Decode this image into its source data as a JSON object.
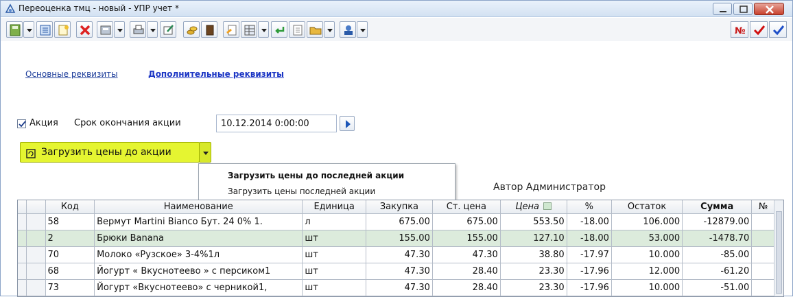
{
  "window": {
    "title": "Переоценка тмц - новый - УПР учет *"
  },
  "tabs": {
    "basic": "Основные реквизиты",
    "extra": "Дополнительные реквизиты"
  },
  "promo": {
    "checkbox_label": "Акция",
    "end_label": "Срок окончания акции",
    "end_value": "10.12.2014 0:00:00",
    "checked": true
  },
  "load_button": {
    "label": "Загрузить цены до акции"
  },
  "menu": {
    "items": [
      "Загрузить цены до последней акции",
      "Загрузить цены последней акции"
    ]
  },
  "author": "Автор Администратор",
  "table": {
    "columns": [
      "Код",
      "Наименование",
      "Единица",
      "Закупка",
      "Ст. цена",
      "Цена",
      "%",
      "Остаток",
      "Сумма",
      "№"
    ],
    "rows": [
      {
        "code": "58",
        "name": "Вермут Martini Bianco Бут. 24 0% 1.",
        "unit": "л",
        "purchase": "675.00",
        "old_price": "675.00",
        "price": "553.50",
        "pct": "-18.00",
        "stock": "106.000",
        "sum": "-12879.00"
      },
      {
        "code": "2",
        "name": "Брюки Banana",
        "unit": "шт",
        "purchase": "155.00",
        "old_price": "155.00",
        "price": "127.10",
        "pct": "-18.00",
        "stock": "53.000",
        "sum": "-1478.70"
      },
      {
        "code": "70",
        "name": "Молоко «Рузское» 3-4%1л",
        "unit": "шт",
        "purchase": "47.30",
        "old_price": "47.30",
        "price": "38.80",
        "pct": "-17.97",
        "stock": "10.000",
        "sum": "-85.00"
      },
      {
        "code": "68",
        "name": "Йогурт « Вкуснотеево » с персиком1",
        "unit": "шт",
        "purchase": "47.30",
        "old_price": "28.40",
        "price": "23.30",
        "pct": "-17.96",
        "stock": "12.000",
        "sum": "-61.20"
      },
      {
        "code": "73",
        "name": "Йогурт «Вкуснотеево» с черникой1,",
        "unit": "шт",
        "purchase": "47.30",
        "old_price": "28.40",
        "price": "23.30",
        "pct": "-17.96",
        "stock": "10.000",
        "sum": "-51.00"
      }
    ]
  },
  "colors": {
    "accent_button": "#e5f531",
    "link": "#1b35c4",
    "selected_row": "#dcebdc"
  },
  "icons": [
    "app-icon",
    "minimize-icon",
    "maximize-icon",
    "close-icon",
    "calendar-arrow-icon",
    "refresh-icon",
    "dropdown-arrow-icon",
    "delete-icon",
    "print-icon",
    "number-icon",
    "check-icon"
  ]
}
